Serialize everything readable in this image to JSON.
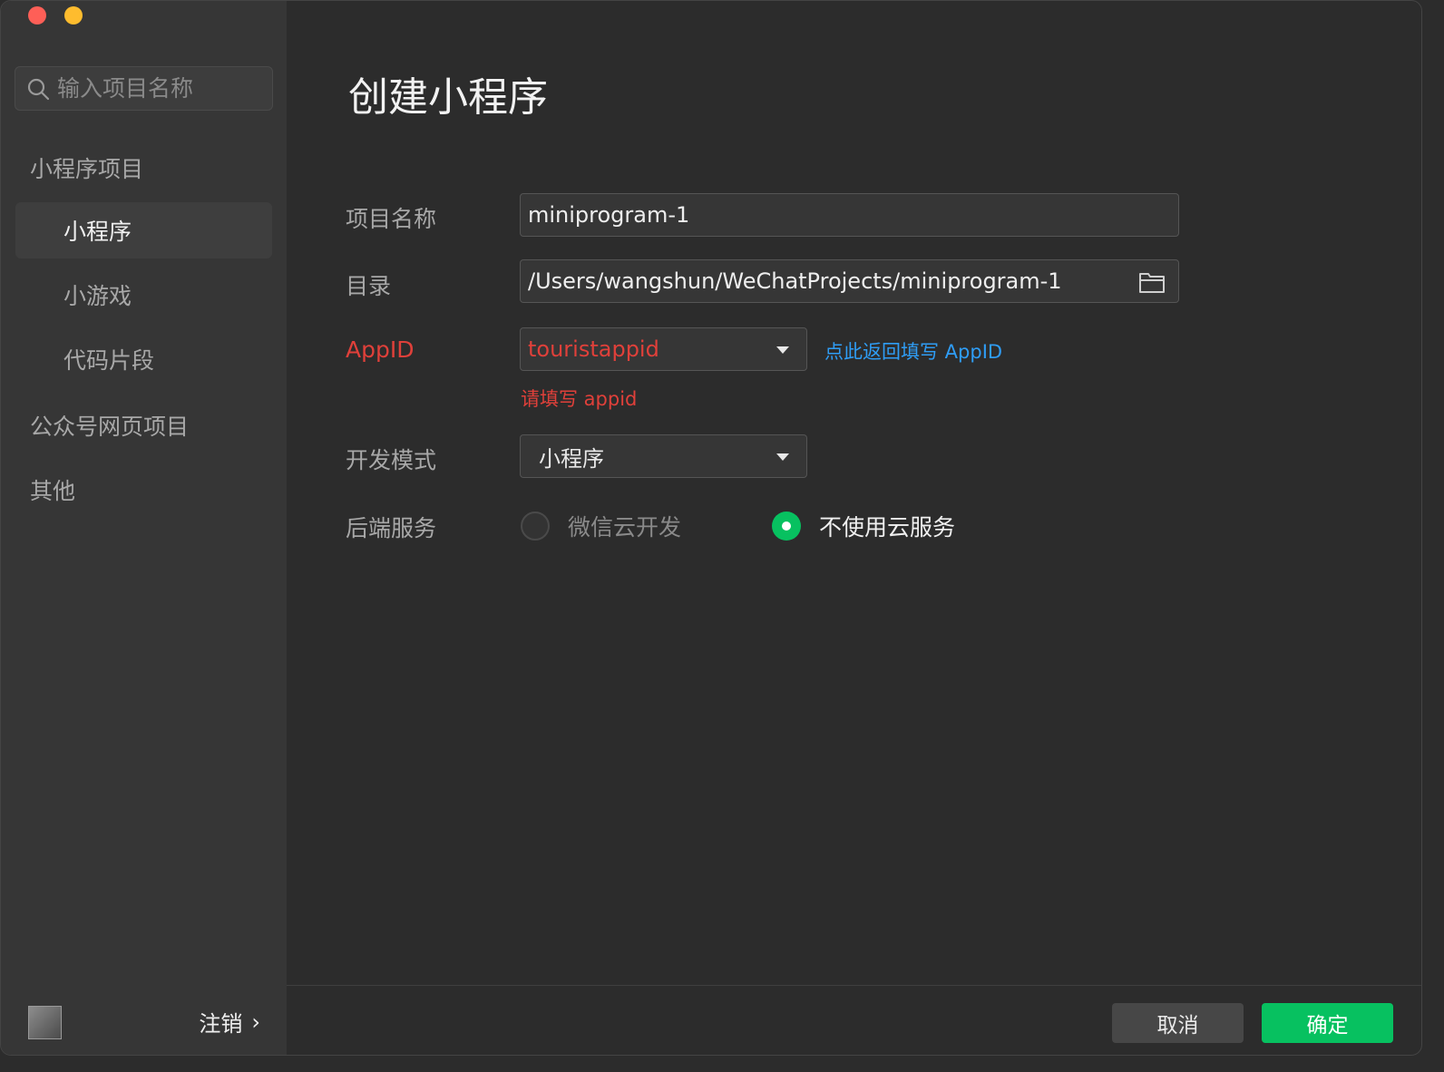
{
  "sidebar": {
    "search_placeholder": "输入项目名称",
    "group_miniprogram": "小程序项目",
    "items": [
      {
        "label": "小程序"
      },
      {
        "label": "小游戏"
      },
      {
        "label": "代码片段"
      }
    ],
    "group_official": "公众号网页项目",
    "group_other": "其他",
    "logout_label": "注销",
    "logout_chevron": "›"
  },
  "main": {
    "title": "创建小程序",
    "project_name_label": "项目名称",
    "project_name_value": "miniprogram-1",
    "directory_label": "目录",
    "directory_value": "/Users/wangshun/WeChatProjects/miniprogram-1",
    "appid_label": "AppID",
    "appid_value": "touristappid",
    "appid_link": "点此返回填写 AppID",
    "appid_error": "请填写 appid",
    "dev_mode_label": "开发模式",
    "dev_mode_value": "小程序",
    "backend_label": "后端服务",
    "backend_options": [
      "微信云开发",
      "不使用云服务"
    ],
    "backend_selected": "不使用云服务"
  },
  "footer": {
    "cancel_label": "取消",
    "confirm_label": "确定"
  },
  "colors": {
    "accent_green": "#07c160",
    "error_red": "#e0403a",
    "link_blue": "#2f9df5"
  }
}
